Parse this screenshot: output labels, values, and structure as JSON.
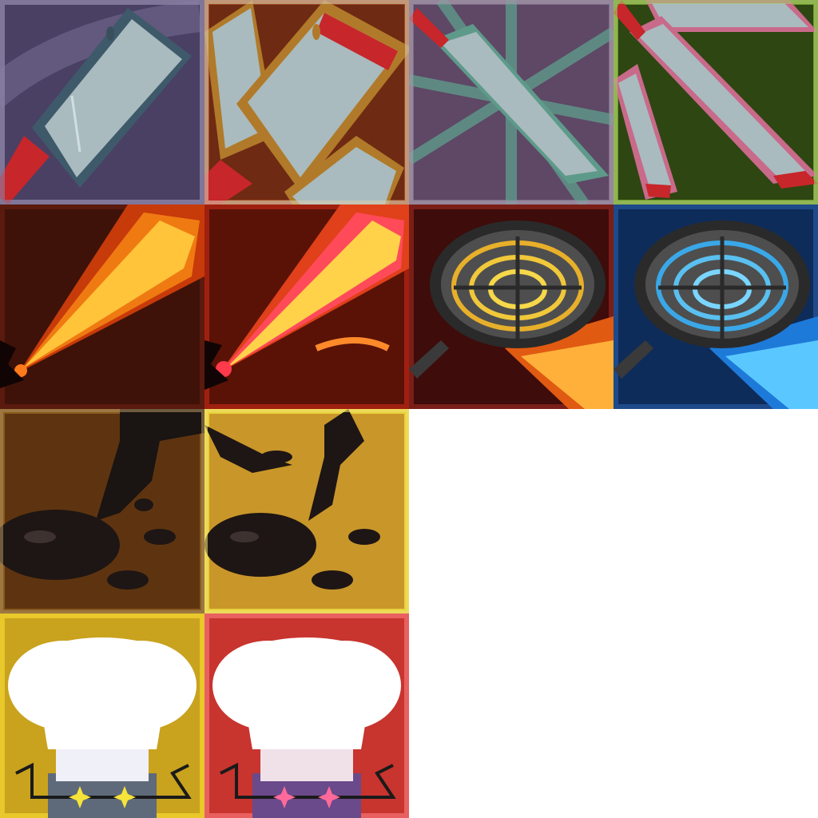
{
  "sheet": {
    "background": "#ffffff",
    "columns": 4,
    "rows": 4
  },
  "icons": [
    {
      "icon": "cleaver-icon",
      "bg": "#5a4e6e",
      "variant": "single"
    },
    {
      "icon": "cleavers-bloody-icon",
      "bg": "#8a3b1e",
      "variant": "triple"
    },
    {
      "icon": "chef-knife-icon",
      "bg": "#5e4b66",
      "variant": "single"
    },
    {
      "icon": "knives-bloody-icon",
      "bg": "#3a5a16",
      "variant": "triple"
    },
    {
      "icon": "flame-jet-icon",
      "bg": "#3e1208",
      "variant": "orange"
    },
    {
      "icon": "flame-jet-hot-icon",
      "bg": "#5a1206",
      "variant": "red"
    },
    {
      "icon": "hot-plate-icon",
      "bg": "#5a1a14",
      "variant": "fire"
    },
    {
      "icon": "hot-plate-cold-icon",
      "bg": "#0e2c5a",
      "variant": "ice"
    },
    {
      "icon": "oil-spill-icon",
      "bg": "#6a3a0e",
      "variant": "dark"
    },
    {
      "icon": "oil-spill-bright-icon",
      "bg": "#c9a21e",
      "variant": "bright"
    },
    {
      "icon": "chef-hat-icon",
      "bg": "#d8b81e",
      "variant": "gold"
    },
    {
      "icon": "chef-hat-red-icon",
      "bg": "#d8423a",
      "variant": "red"
    }
  ]
}
